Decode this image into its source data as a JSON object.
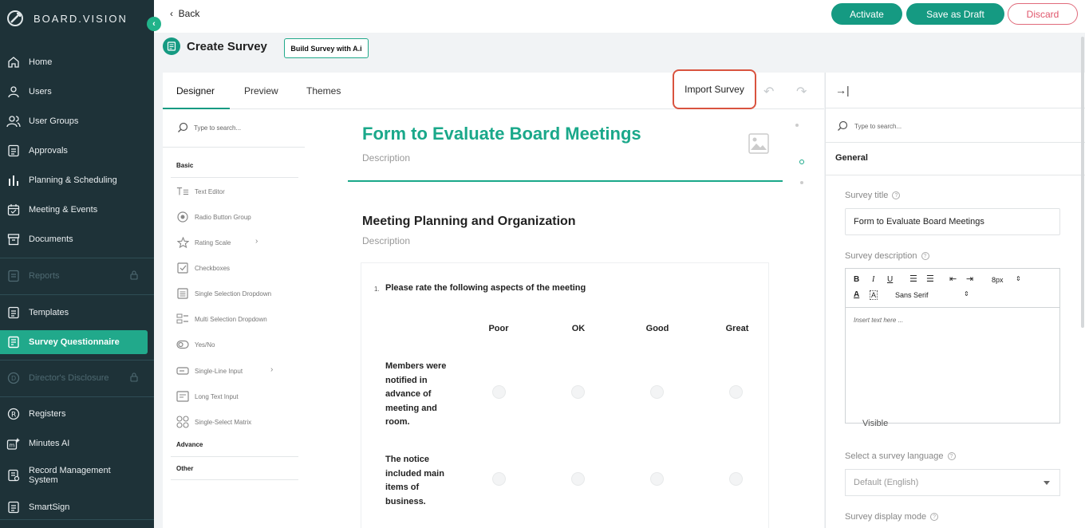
{
  "brand": {
    "name": "BOARD.VISION"
  },
  "sidebar": {
    "items": [
      {
        "label": "Home",
        "icon": "home-icon"
      },
      {
        "label": "Users",
        "icon": "user-icon"
      },
      {
        "label": "User Groups",
        "icon": "users-icon"
      },
      {
        "label": "Approvals",
        "icon": "approvals-icon"
      },
      {
        "label": "Planning & Scheduling",
        "icon": "chart-bars-icon"
      },
      {
        "label": "Meeting & Events",
        "icon": "calendar-icon"
      },
      {
        "label": "Documents",
        "icon": "archive-icon"
      },
      {
        "label": "Reports",
        "icon": "report-icon",
        "disabled": true
      },
      {
        "label": "Templates",
        "icon": "template-icon"
      },
      {
        "label": "Survey Questionnaire",
        "icon": "survey-icon",
        "active": true
      },
      {
        "label": "Director's Disclosure",
        "icon": "disclosure-icon",
        "disabled": true
      },
      {
        "label": "Registers",
        "icon": "registered-icon"
      },
      {
        "label": "Minutes AI",
        "icon": "minutes-ai-icon"
      },
      {
        "label": "Record Management System",
        "icon": "record-icon"
      },
      {
        "label": "SmartSign",
        "icon": "smartsign-icon"
      }
    ]
  },
  "topbar": {
    "back": "Back",
    "activate": "Activate",
    "save_draft": "Save as Draft",
    "discard": "Discard"
  },
  "header": {
    "title": "Create Survey",
    "ai_button": "Build Survey with A.i"
  },
  "designer": {
    "tabs": [
      "Designer",
      "Preview",
      "Themes"
    ],
    "import": "Import Survey"
  },
  "toolbox": {
    "search_placeholder": "Type to search...",
    "categories": {
      "basic": "Basic",
      "advance": "Advance",
      "other": "Other"
    },
    "items": [
      "Text Editor",
      "Radio Button Group",
      "Rating Scale",
      "Checkboxes",
      "Single Selection Dropdown",
      "Multi Selection Dropdown",
      "Yes/No",
      "Single-Line Input",
      "Long Text Input",
      "Single-Select Matrix"
    ]
  },
  "survey": {
    "title": "Form to Evaluate Board Meetings",
    "description": "Description",
    "section_title": "Meeting Planning and Organization",
    "section_description": "Description",
    "question": {
      "number": "1.",
      "text": "Please rate the following aspects of the meeting",
      "columns": [
        "Poor",
        "OK",
        "Good",
        "Great"
      ],
      "rows": [
        "Members were notified in advance of meeting and room.",
        "The notice included main items of business."
      ]
    }
  },
  "properties": {
    "search_placeholder": "Type to search...",
    "section": "General",
    "title_label": "Survey title",
    "title_value": "Form to Evaluate Board Meetings",
    "description_label": "Survey description",
    "editor": {
      "font_size": "8px",
      "font": "Sans Serif",
      "placeholder": "Insert text here ..."
    },
    "visible_text": "Visible",
    "language_label": "Select a survey language",
    "language_value": "Default (English)",
    "display_mode_label": "Survey display mode"
  }
}
